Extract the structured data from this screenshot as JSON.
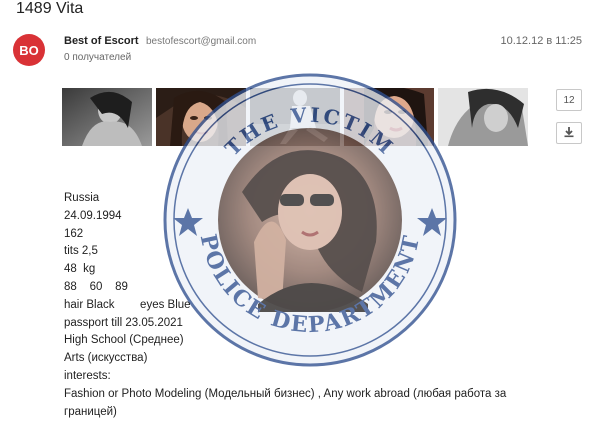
{
  "email": {
    "subject": "1489 Vita",
    "sender": {
      "avatar_initials": "BO",
      "name": "Best of Escort",
      "email": "bestofescort@gmail.com"
    },
    "recipients": "0 получателей",
    "date": "10.12.12 в 11:25"
  },
  "attachments": {
    "thumbnails": [
      {
        "description": "photo-1"
      },
      {
        "description": "photo-2"
      },
      {
        "description": "photo-3"
      },
      {
        "description": "photo-4"
      },
      {
        "description": "photo-5"
      }
    ],
    "count": "12",
    "download_icon": "download-icon"
  },
  "watermark": {
    "top_text": "THE VICTIM",
    "bottom_text": "POLICE DEPARTMENT",
    "colors": {
      "ring": "#2f4f8f",
      "text": "#2f4f8f",
      "star": "#2f4f8f",
      "fill": "#eef2f8"
    }
  },
  "body": {
    "lines": [
      "Russia",
      "24.09.1994",
      "162",
      "tits 2,5",
      "48  kg",
      "88    60    89",
      "hair Black        eyes Blue",
      "passport till 23.05.2021",
      "High School (Среднее)",
      "Arts (искусства)",
      "interests:",
      "Fashion or Photo Modeling (Модельный бизнес) , Any work abroad (любая работа за",
      "границей)"
    ]
  },
  "colors": {
    "avatar_bg": "#d93236",
    "text": "#222222",
    "muted": "#777777"
  }
}
